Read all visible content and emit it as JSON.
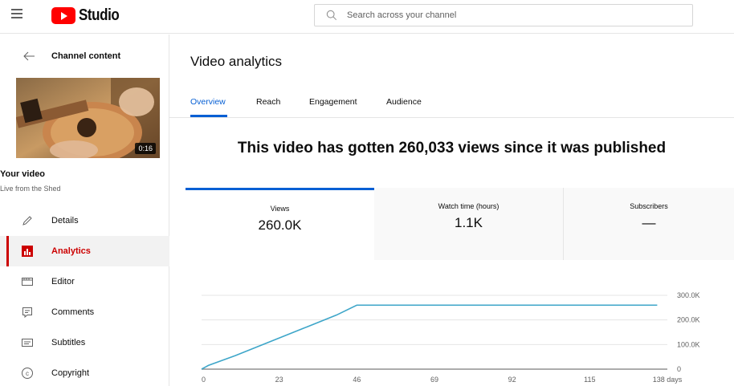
{
  "header": {
    "logo_text": "Studio",
    "search_placeholder": "Search across your channel"
  },
  "sidebar": {
    "back_label": "Channel content",
    "video": {
      "duration": "0:16",
      "title": "Your video",
      "subtitle": "Live from the Shed"
    },
    "items": [
      {
        "label": "Details",
        "icon": "pencil-icon",
        "active": false
      },
      {
        "label": "Analytics",
        "icon": "analytics-icon",
        "active": true
      },
      {
        "label": "Editor",
        "icon": "editor-icon",
        "active": false
      },
      {
        "label": "Comments",
        "icon": "comments-icon",
        "active": false
      },
      {
        "label": "Subtitles",
        "icon": "subtitles-icon",
        "active": false
      },
      {
        "label": "Copyright",
        "icon": "copyright-icon",
        "active": false
      }
    ]
  },
  "main": {
    "title": "Video analytics",
    "tabs": [
      {
        "label": "Overview",
        "active": true
      },
      {
        "label": "Reach",
        "active": false
      },
      {
        "label": "Engagement",
        "active": false
      },
      {
        "label": "Audience",
        "active": false
      }
    ],
    "headline": "This video has gotten 260,033 views since it was published",
    "metrics": [
      {
        "label": "Views",
        "value": "260.0K",
        "active": true
      },
      {
        "label": "Watch time (hours)",
        "value": "1.1K",
        "active": false
      },
      {
        "label": "Subscribers",
        "value": "—",
        "active": false
      }
    ]
  },
  "colors": {
    "accent": "#065fd4",
    "brand_red": "#ff0000",
    "active_nav": "#cc0000",
    "line": "#3ea6c9"
  },
  "chart_data": {
    "type": "line",
    "x_tick_labels": [
      "0",
      "23",
      "46",
      "69",
      "92",
      "115",
      "138 days"
    ],
    "y_tick_labels": [
      "0",
      "100.0K",
      "200.0K",
      "300.0K"
    ],
    "xlim": [
      0,
      138
    ],
    "ylim": [
      0,
      300000
    ],
    "series": [
      {
        "x": [
          0,
          2,
          10,
          20,
          30,
          40,
          46,
          60,
          80,
          100,
          120,
          135
        ],
        "y": [
          0,
          15000,
          55000,
          110000,
          165000,
          220000,
          260033,
          260033,
          260033,
          260033,
          260033,
          260033
        ]
      }
    ],
    "grid": true
  }
}
